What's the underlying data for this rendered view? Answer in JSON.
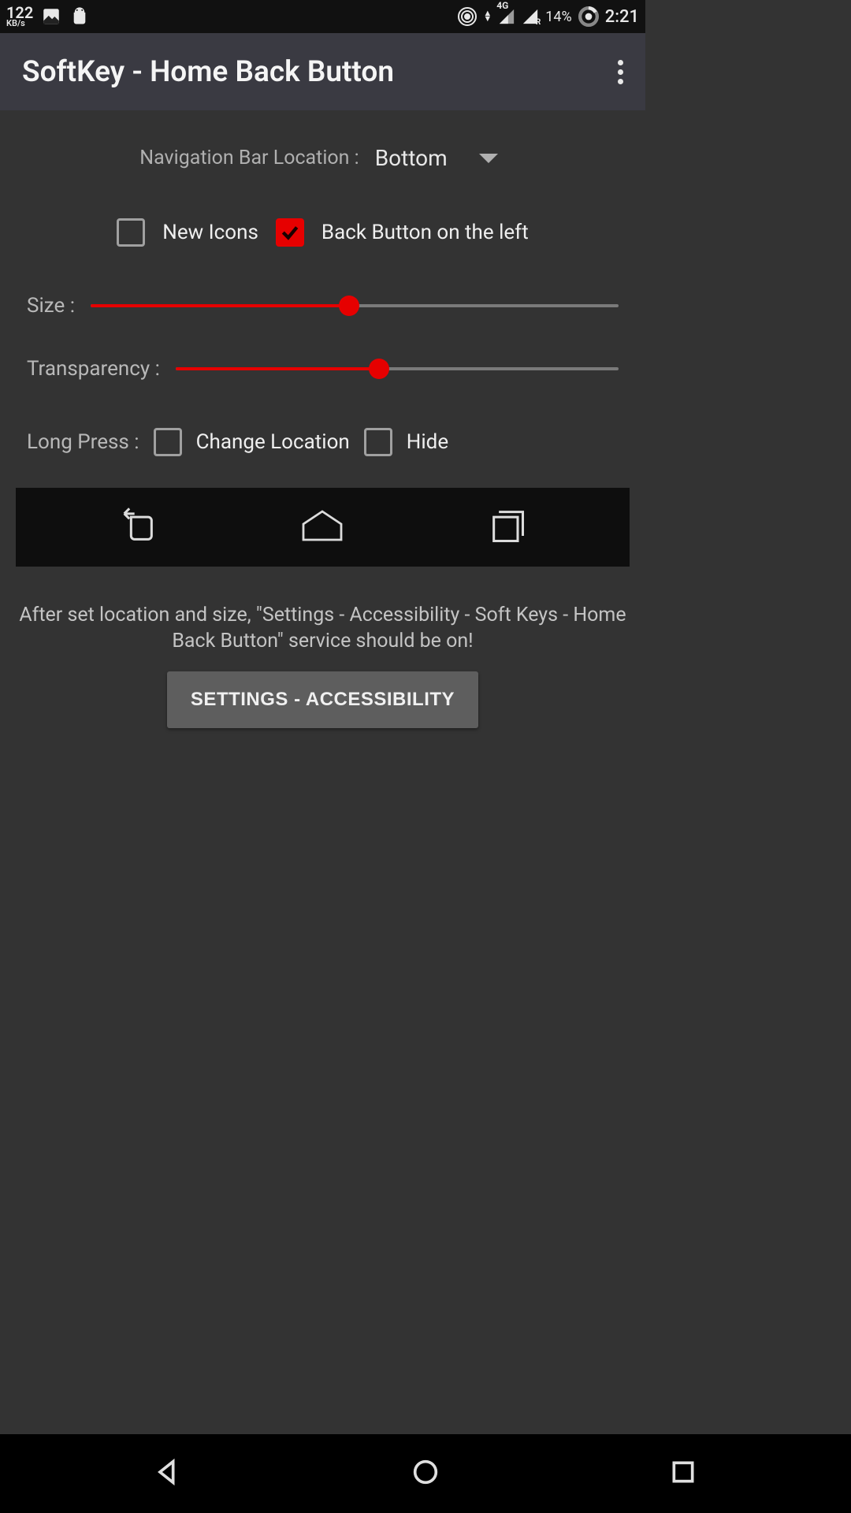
{
  "status": {
    "net_speed_value": "122",
    "net_speed_unit": "KB/s",
    "network_label": "4G",
    "battery_percent": "14%",
    "time": "2:21"
  },
  "appbar": {
    "title": "SoftKey - Home Back Button"
  },
  "settings": {
    "nav_location_label": "Navigation Bar Location :",
    "nav_location_value": "Bottom",
    "new_icons_label": "New Icons",
    "new_icons_checked": false,
    "back_left_label": "Back Button on the left",
    "back_left_checked": true,
    "size_label": "Size :",
    "size_percent": 49,
    "transparency_label": "Transparency :",
    "transparency_percent": 46,
    "long_press_label": "Long Press :",
    "change_location_label": "Change Location",
    "change_location_checked": false,
    "hide_label": "Hide",
    "hide_checked": false,
    "instruction_text": "After set location and size, \"Settings - Accessibility - Soft Keys - Home Back Button\" service should be on!",
    "settings_button_label": "SETTINGS - ACCESSIBILITY"
  },
  "colors": {
    "accent": "#e60000",
    "bg": "#333333",
    "appbar_bg": "#3a3a42"
  }
}
